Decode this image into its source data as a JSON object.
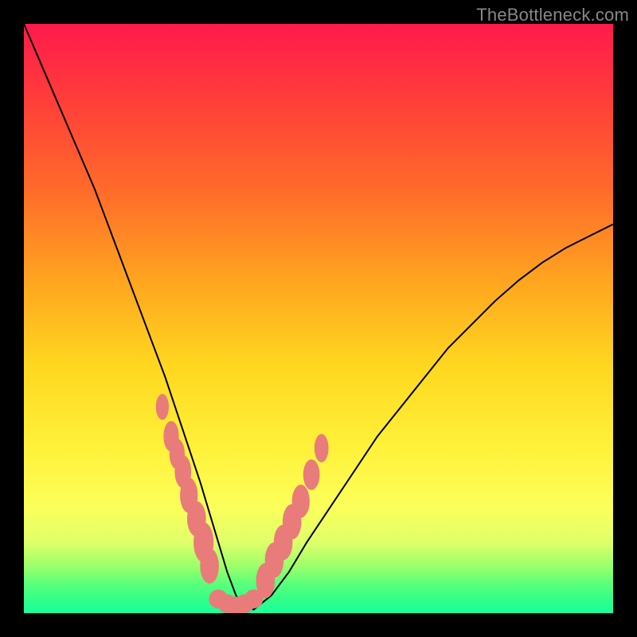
{
  "watermark": "TheBottleneck.com",
  "chart_data": {
    "type": "line",
    "title": "",
    "xlabel": "",
    "ylabel": "",
    "xlim": [
      0,
      100
    ],
    "ylim": [
      0,
      100
    ],
    "series": [
      {
        "name": "bottleneck-curve",
        "x": [
          0,
          3,
          6,
          9,
          12,
          15,
          18,
          21,
          24,
          27,
          30,
          31.5,
          33,
          34.5,
          36,
          37.5,
          39,
          42,
          45,
          48,
          52,
          56,
          60,
          64,
          68,
          72,
          76,
          80,
          84,
          88,
          92,
          96,
          100
        ],
        "y": [
          100,
          93,
          86,
          79,
          72,
          64,
          56,
          48,
          40,
          31,
          22,
          17,
          12,
          7,
          3,
          1,
          0.6,
          3,
          7,
          12,
          18,
          24,
          30,
          35,
          40,
          45,
          49,
          53,
          56.5,
          59.5,
          62,
          64,
          66
        ]
      }
    ],
    "markers": [
      {
        "name": "left-cluster",
        "x": [
          23.5,
          25.0,
          26.0,
          27.0,
          28.0,
          29.3,
          30.5,
          31.5
        ],
        "y": [
          35.0,
          30.0,
          27.0,
          24.0,
          20.0,
          16.0,
          12.0,
          8.0
        ],
        "rx": [
          1.1,
          1.3,
          1.3,
          1.4,
          1.5,
          1.6,
          1.7,
          1.6
        ],
        "ry": [
          2.2,
          2.6,
          2.6,
          2.8,
          3.0,
          3.0,
          3.4,
          3.0
        ]
      },
      {
        "name": "bottom-cluster",
        "x": [
          33.0,
          34.5,
          36.0,
          37.5,
          39.0
        ],
        "y": [
          2.4,
          1.6,
          1.2,
          1.6,
          2.4
        ],
        "rx": [
          1.6,
          1.6,
          1.6,
          1.6,
          1.6
        ],
        "ry": [
          1.6,
          1.6,
          1.6,
          1.6,
          1.6
        ]
      },
      {
        "name": "right-cluster",
        "x": [
          41.0,
          42.5,
          44.0,
          45.5,
          47.0,
          48.8,
          50.5
        ],
        "y": [
          5.5,
          9.0,
          12.0,
          15.5,
          19.0,
          23.5,
          28.0
        ],
        "rx": [
          1.6,
          1.6,
          1.6,
          1.6,
          1.5,
          1.4,
          1.2
        ],
        "ry": [
          3.0,
          3.0,
          3.0,
          3.0,
          2.8,
          2.6,
          2.4
        ]
      }
    ],
    "marker_color": "#e97b7b",
    "curve_color": "#000000"
  }
}
